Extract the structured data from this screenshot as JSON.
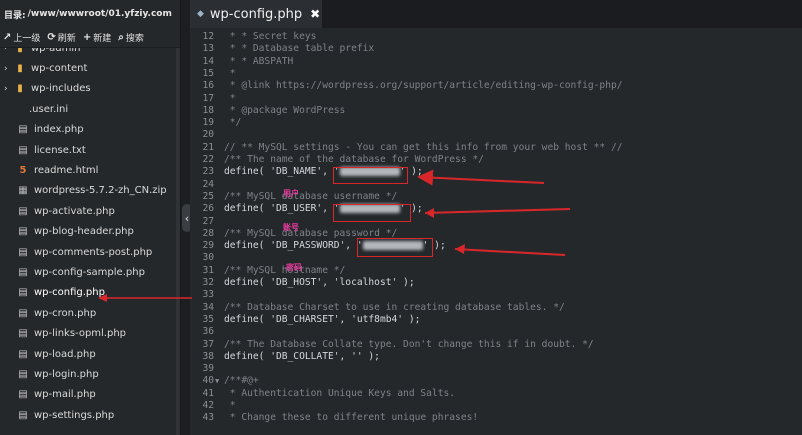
{
  "sidebar": {
    "dir_label": "目录:",
    "dir_path": "/www/wwwroot/01.yfziy.com",
    "toolbar": {
      "back": "上一级",
      "refresh": "刷新",
      "new": "新建",
      "search": "搜索"
    },
    "items": [
      {
        "label": "wp-admin",
        "type": "folder"
      },
      {
        "label": "wp-content",
        "type": "folder"
      },
      {
        "label": "wp-includes",
        "type": "folder"
      },
      {
        "label": ".user.ini",
        "type": "plain"
      },
      {
        "label": "index.php",
        "type": "file"
      },
      {
        "label": "license.txt",
        "type": "text"
      },
      {
        "label": "readme.html",
        "type": "html"
      },
      {
        "label": "wordpress-5.7.2-zh_CN.zip",
        "type": "zip"
      },
      {
        "label": "wp-activate.php",
        "type": "file"
      },
      {
        "label": "wp-blog-header.php",
        "type": "file"
      },
      {
        "label": "wp-comments-post.php",
        "type": "file"
      },
      {
        "label": "wp-config-sample.php",
        "type": "file"
      },
      {
        "label": "wp-config.php",
        "type": "file"
      },
      {
        "label": "wp-cron.php",
        "type": "file"
      },
      {
        "label": "wp-links-opml.php",
        "type": "file"
      },
      {
        "label": "wp-load.php",
        "type": "file"
      },
      {
        "label": "wp-login.php",
        "type": "file"
      },
      {
        "label": "wp-mail.php",
        "type": "file"
      },
      {
        "label": "wp-settings.php",
        "type": "file"
      }
    ]
  },
  "editor": {
    "tab_label": "wp-config.php",
    "close_glyph": "✖",
    "lines": [
      {
        "n": "12",
        "t": " * * Secret keys",
        "cls": "c"
      },
      {
        "n": "13",
        "t": " * * Database table prefix",
        "cls": "c"
      },
      {
        "n": "14",
        "t": " * * ABSPATH",
        "cls": "c"
      },
      {
        "n": "15",
        "t": " *",
        "cls": "c"
      },
      {
        "n": "16",
        "t": " * @link https://wordpress.org/support/article/editing-wp-config-php/",
        "cls": "c"
      },
      {
        "n": "17",
        "t": " *",
        "cls": "c"
      },
      {
        "n": "18",
        "t": " * @package WordPress",
        "cls": "c"
      },
      {
        "n": "19",
        "t": " */",
        "cls": "c"
      },
      {
        "n": "20",
        "t": "",
        "cls": "c"
      },
      {
        "n": "21",
        "t": "// ** MySQL settings - You can get this info from your web host ** //",
        "cls": "c"
      },
      {
        "n": "22",
        "t": "/** The name of the database for WordPress */",
        "cls": "c"
      },
      {
        "n": "23",
        "t": "define( 'DB_NAME', '",
        "tail": "' );",
        "cls": "k",
        "blur": true
      },
      {
        "n": "24",
        "t": "",
        "cls": "c"
      },
      {
        "n": "25",
        "t": "/** MySQL database username */",
        "cls": "c"
      },
      {
        "n": "26",
        "t": "define( 'DB_USER', '",
        "tail": "' );",
        "cls": "k",
        "blur": true
      },
      {
        "n": "27",
        "t": "",
        "cls": "c"
      },
      {
        "n": "28",
        "t": "/** MySQL database password */",
        "cls": "c"
      },
      {
        "n": "29",
        "t": "define( 'DB_PASSWORD', '",
        "tail": "' );",
        "cls": "k",
        "blur": true
      },
      {
        "n": "30",
        "t": "",
        "cls": "c"
      },
      {
        "n": "31",
        "t": "/** MySQL hostname */",
        "cls": "c"
      },
      {
        "n": "32",
        "t": "define( 'DB_HOST', 'localhost' );",
        "cls": "k"
      },
      {
        "n": "33",
        "t": "",
        "cls": "c"
      },
      {
        "n": "34",
        "t": "/** Database Charset to use in creating database tables. */",
        "cls": "c"
      },
      {
        "n": "35",
        "t": "define( 'DB_CHARSET', 'utf8mb4' );",
        "cls": "k"
      },
      {
        "n": "36",
        "t": "",
        "cls": "c"
      },
      {
        "n": "37",
        "t": "/** The Database Collate type. Don't change this if in doubt. */",
        "cls": "c"
      },
      {
        "n": "38",
        "t": "define( 'DB_COLLATE', '' );",
        "cls": "k"
      },
      {
        "n": "39",
        "t": "",
        "cls": "c"
      },
      {
        "n": "40",
        "t": "/**#@+",
        "cls": "c",
        "fold": true
      },
      {
        "n": "41",
        "t": " * Authentication Unique Keys and Salts.",
        "cls": "c"
      },
      {
        "n": "42",
        "t": " *",
        "cls": "c"
      },
      {
        "n": "43",
        "t": " * Change these to different unique phrases!",
        "cls": "c"
      }
    ]
  },
  "annotations": {
    "user_label": "用户",
    "pass_label": "账号",
    "pwd_label": "密码",
    "arrow_color": "#d9262a",
    "label_color": "#e83aa0"
  }
}
